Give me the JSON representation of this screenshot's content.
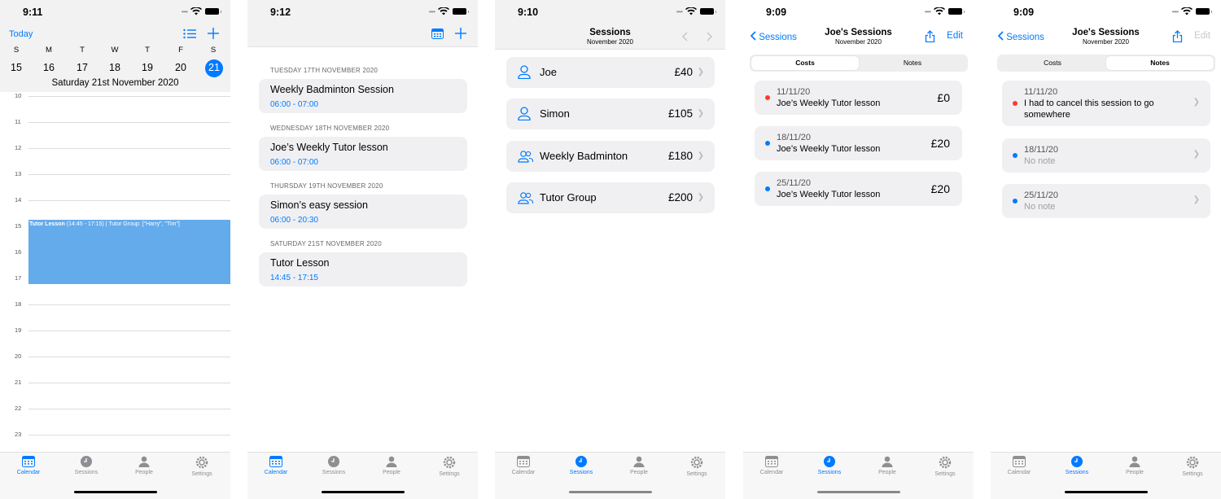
{
  "colors": {
    "accent": "#007aff",
    "event": "#64abec",
    "red_dot": "#ff3b30",
    "blue_dot": "#007aff"
  },
  "tabs": [
    "Calendar",
    "Sessions",
    "People",
    "Settings"
  ],
  "screen1": {
    "time": "9:11",
    "today": "Today",
    "weekdays": [
      "S",
      "M",
      "T",
      "W",
      "T",
      "F",
      "S"
    ],
    "days": [
      "15",
      "16",
      "17",
      "18",
      "19",
      "20",
      "21"
    ],
    "selected_day": "21",
    "date_title": "Saturday 21st November 2020",
    "hours": [
      "10",
      "11",
      "12",
      "13",
      "14",
      "15",
      "16",
      "17",
      "18",
      "19",
      "20",
      "21",
      "22",
      "23"
    ],
    "event": {
      "name": "Tutor Lesson",
      "detail": " (14:45 - 17:15) | Tutor Group: [\"Harry\", \"Tim\"]"
    }
  },
  "screen2": {
    "time": "9:12",
    "groups": [
      {
        "header": "TUESDAY 17TH NOVEMBER 2020",
        "title": "Weekly Badminton Session",
        "time": "06:00 - 07:00"
      },
      {
        "header": "WEDNESDAY 18TH NOVEMBER 2020",
        "title": "Joe’s Weekly Tutor lesson",
        "time": "06:00 - 07:00"
      },
      {
        "header": "THURSDAY 19TH NOVEMBER 2020",
        "title": "Simon’s easy session",
        "time": "06:00 - 20:30"
      },
      {
        "header": "SATURDAY 21ST NOVEMBER 2020",
        "title": "Tutor Lesson",
        "time": "14:45 - 17:15"
      }
    ]
  },
  "screen3": {
    "time": "9:10",
    "title": "Sessions",
    "subtitle": "November 2020",
    "items": [
      {
        "name": "Joe",
        "amount": "£40",
        "icon": "person-icon"
      },
      {
        "name": "Simon",
        "amount": "£105",
        "icon": "person-icon"
      },
      {
        "name": "Weekly Badminton",
        "amount": "£180",
        "icon": "group-icon"
      },
      {
        "name": "Tutor Group",
        "amount": "£200",
        "icon": "group-icon"
      }
    ]
  },
  "screen4": {
    "time": "9:09",
    "back": "Sessions",
    "title": "Joe's Sessions",
    "subtitle": "November 2020",
    "edit": "Edit",
    "segments": [
      "Costs",
      "Notes"
    ],
    "costs": [
      {
        "date": "11/11/20",
        "desc": "Joe’s Weekly Tutor lesson",
        "amount": "£0",
        "dot": "red"
      },
      {
        "date": "18/11/20",
        "desc": "Joe’s Weekly Tutor lesson",
        "amount": "£20",
        "dot": "blue"
      },
      {
        "date": "25/11/20",
        "desc": "Joe’s Weekly Tutor lesson",
        "amount": "£20",
        "dot": "blue"
      }
    ]
  },
  "screen5": {
    "time": "9:09",
    "back": "Sessions",
    "title": "Joe's Sessions",
    "subtitle": "November 2020",
    "edit": "Edit",
    "segments": [
      "Costs",
      "Notes"
    ],
    "notes": [
      {
        "date": "11/11/20",
        "text": "I had to cancel this session to go somewhere",
        "dot": "red"
      },
      {
        "date": "18/11/20",
        "text": "No note",
        "dot": "blue"
      },
      {
        "date": "25/11/20",
        "text": "No note",
        "dot": "blue"
      }
    ]
  }
}
